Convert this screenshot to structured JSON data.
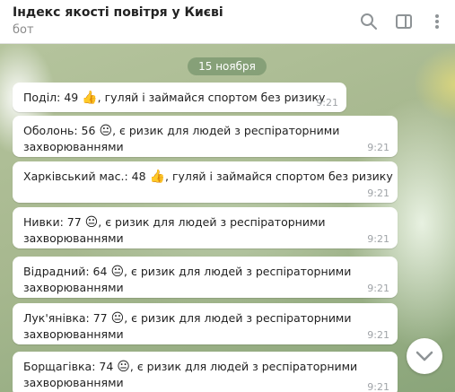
{
  "header": {
    "title": "Індекс якості повітря у Києві",
    "subtitle": "бот"
  },
  "date_label": "15 ноября",
  "messages": [
    {
      "district": "Поділ: 49",
      "emoji": "👍",
      "message": ", гуляй і займайся спортом без ризику",
      "continuation": "",
      "time": "9:21"
    },
    {
      "district": "Оболонь: 56",
      "emoji": "😐",
      "message": ", є ризик для людей з респіраторними",
      "continuation": "захворюваннями",
      "time": "9:21"
    },
    {
      "district": "Харківський мас.: 48",
      "emoji": "👍",
      "message": ", гуляй і займайся спортом без ризику",
      "continuation": "",
      "time": "9:21"
    },
    {
      "district": "Нивки: 77",
      "emoji": "😐",
      "message": ", є ризик для людей з респіраторними",
      "continuation": "захворюваннями",
      "time": "9:21"
    },
    {
      "district": "Відрадний: 64",
      "emoji": "😐",
      "message": ", є ризик для людей з респіраторними",
      "continuation": "захворюваннями",
      "time": "9:21"
    },
    {
      "district": "Лук'янівка: 77",
      "emoji": "😐",
      "message": ", є ризик для людей з респіраторними",
      "continuation": "захворюваннями",
      "time": "9:21"
    },
    {
      "district": "Борщагівка: 74",
      "emoji": "😐",
      "message": ", є ризик для людей з респіраторними",
      "continuation": "захворюваннями",
      "time": "9:21"
    }
  ],
  "icons": [
    "search-icon",
    "sidebar-panel-icon",
    "more-vertical-icon",
    "chevron-down-icon"
  ],
  "colors": {
    "date_pill": "#7d9a6f",
    "time": "#a0a4a8",
    "bubble": "#ffffff"
  }
}
